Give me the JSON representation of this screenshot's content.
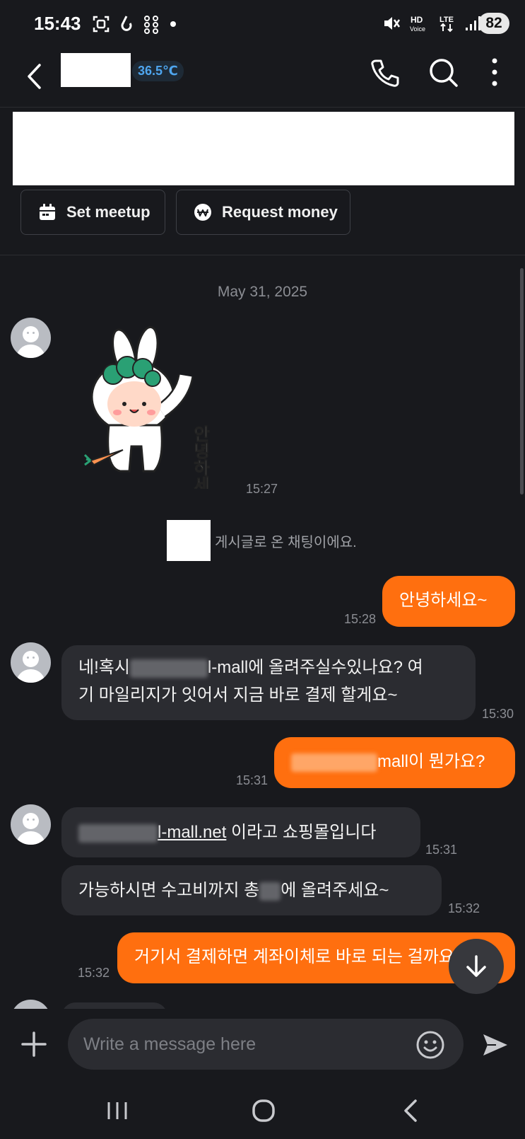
{
  "status_bar": {
    "time": "15:43",
    "battery": "82",
    "icons": [
      "screenshot-icon",
      "notification-icon",
      "dots-grid-icon",
      "mute-icon",
      "hd-voice-icon",
      "lte-icon",
      "signal-icon",
      "battery-icon"
    ]
  },
  "header": {
    "temperature": "36.5℃",
    "icons": [
      "back-arrow-icon",
      "phone-icon",
      "search-icon",
      "more-vert-icon"
    ]
  },
  "actions": {
    "set_meetup": "Set meetup",
    "request_money": "Request money"
  },
  "chat": {
    "date": "May 31, 2025",
    "sticker_text": "안녕하세요",
    "sticker_time": "15:27",
    "notice": "게시글로 온 채팅이에요.",
    "messages": [
      {
        "id": "m1",
        "from": "me",
        "text": "안녕하세요~",
        "time": "15:28"
      },
      {
        "id": "m2",
        "from": "them",
        "line1_pre": "네!혹시",
        "line1_post": "l-mall에 올려주실수있나요? 여",
        "line2": "기 마일리지가 잇어서 지금 바로 결제 할게요~",
        "time": "15:30"
      },
      {
        "id": "m3",
        "from": "me",
        "text_post": "mall이 뭔가요?",
        "time": "15:31"
      },
      {
        "id": "m4",
        "from": "them",
        "link": "l-mall.net",
        "text_post": " 이라고 쇼핑몰입니다",
        "time": "15:31"
      },
      {
        "id": "m5",
        "from": "them",
        "text_pre": "가능하시면 수고비까지 총",
        "text_post": "에 올려주세요~",
        "time": "15:32"
      },
      {
        "id": "m6",
        "from": "me",
        "text": "거기서 결제하면 계좌이체로 바로 되는 걸까요?",
        "time": "15:32"
      }
    ]
  },
  "input": {
    "placeholder": "Write a message here"
  },
  "colors": {
    "background": "#18191d",
    "incoming_bubble": "#2b2c31",
    "outgoing_bubble": "#ff6f0f",
    "temperature_blue": "#4ea5ee",
    "muted_text": "#8b8d93"
  },
  "nav": {
    "icons": [
      "recent-apps-icon",
      "home-icon",
      "nav-back-icon"
    ]
  }
}
